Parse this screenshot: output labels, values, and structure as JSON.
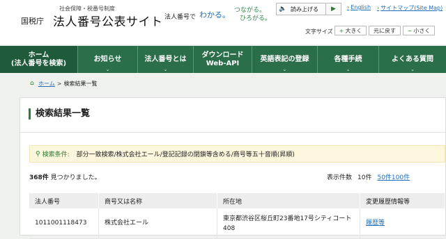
{
  "header": {
    "logo_sub": "社会保障・税番号制度",
    "agency": "国税庁",
    "site_title": "法人番号公表サイト",
    "tagline": {
      "a": "法人番号で",
      "b": "わかる。",
      "c": "つながる。",
      "d": "ひろがる。"
    },
    "read_aloud": "読み上げる",
    "english": "English",
    "sitemap": "サイトマップ(Site Map)",
    "font_size_label": "文字サイズ",
    "font_larger": "大きく",
    "font_reset": "元に戻す",
    "font_smaller": "小さく"
  },
  "nav": {
    "items": [
      {
        "line1": "ホーム",
        "line2": "(法人番号を検索)"
      },
      {
        "line1": "お知らせ",
        "line2": ""
      },
      {
        "line1": "法人番号とは",
        "line2": ""
      },
      {
        "line1": "ダウンロード",
        "line2": "Web-API"
      },
      {
        "line1": "英語表記の登録",
        "line2": ""
      },
      {
        "line1": "各種手続",
        "line2": ""
      },
      {
        "line1": "よくある質問",
        "line2": ""
      }
    ]
  },
  "breadcrumb": {
    "home": "ホーム",
    "separator": ">",
    "current": "検索結果一覧"
  },
  "panel": {
    "title": "検索結果一覧",
    "condition_label": "検索条件:",
    "condition_text": "部分一致検索/株式会社エール/登記記録の閉鎖等含める/商号等五十音順(昇順)",
    "count": "368件",
    "count_suffix": " 見つかりました。",
    "perpage_label": "表示件数",
    "perpage_current": "10件",
    "perpage_50": "50件",
    "perpage_100": "100件"
  },
  "table": {
    "headers": [
      "法人番号",
      "商号又は名称",
      "所在地",
      "変更履歴情報等"
    ],
    "rows": [
      {
        "number": "1011001118473",
        "name": "株式会社エール",
        "address": "東京都渋谷区桜丘町23番地17号シティコート408",
        "history": "履歴等"
      }
    ]
  },
  "colors": {
    "nav_green": "#2b6e4a",
    "accent_green": "#2e7d32",
    "link_blue": "#1e6fb8",
    "condition_bg": "#fcf6dd"
  }
}
